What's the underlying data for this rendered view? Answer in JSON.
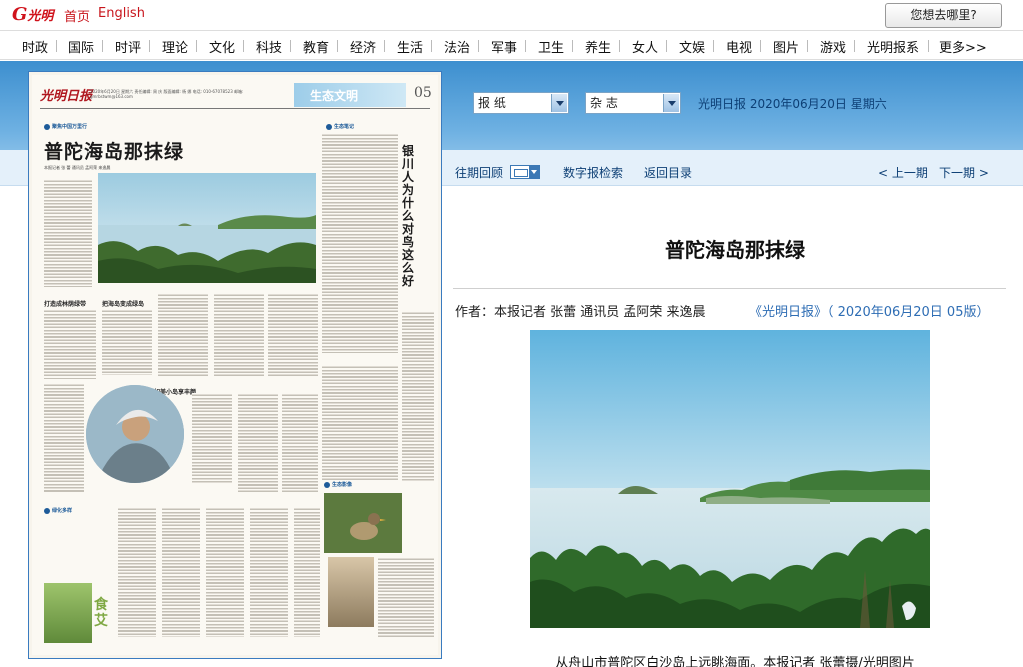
{
  "site": {
    "logo_text": "光明网",
    "top_links": [
      "首页",
      "English"
    ],
    "search_label": "您想去哪里?"
  },
  "nav": [
    "时政",
    "国际",
    "时评",
    "理论",
    "文化",
    "科技",
    "教育",
    "经济",
    "生活",
    "法治",
    "军事",
    "卫生",
    "养生",
    "女人",
    "文娱",
    "电视",
    "图片",
    "游戏",
    "光明报系",
    "更多>>"
  ],
  "epaper": {
    "select_newspaper": "报 纸",
    "select_magazine": "杂 志",
    "dateline": "光明日报 2020年06月20日 星期六",
    "toolbar": {
      "past_issues": "往期回顾",
      "search": "数字报检索",
      "back": "返回目录",
      "prev": "< 上一期",
      "next": "下一期 >"
    }
  },
  "newspaper_page": {
    "masthead": "光明日报",
    "date_info": "2020年6月20日 星期六 责任编辑: 周 庆 版面编辑: 杨 娜 电话: 010-67078523 邮箱: gmrbstwm@163.com",
    "section": "生态文明",
    "page_no": "05",
    "column_left": "聚焦中国万里行",
    "column_right": "生态笔记",
    "headline": "普陀海岛那抹绿",
    "byline": "本报记者 张 蕾  通讯员 孟阿荣  来逸晨",
    "vertical_headline": "银川人为什么对鸟这么好",
    "subheads": [
      "打造成林荫绿带",
      "把海岛变成绿岛",
      "如美小岛享丰颜",
      "绿化多样"
    ],
    "dish": "食艾",
    "column_eco": "生态影像"
  },
  "article": {
    "title": "普陀海岛那抹绿",
    "author": "作者：本报记者 张蕾 通讯员 孟阿荣 来逸晨",
    "source": "《光明日报》（ 2020年06月20日 05版）",
    "caption": "从舟山市普陀区白沙岛上远眺海面。本报记者 张蕾摄/光明图片"
  },
  "colors": {
    "brand_red": "#c8161d",
    "band_blue": "#3d8fcf",
    "link_blue": "#2e6db4"
  }
}
